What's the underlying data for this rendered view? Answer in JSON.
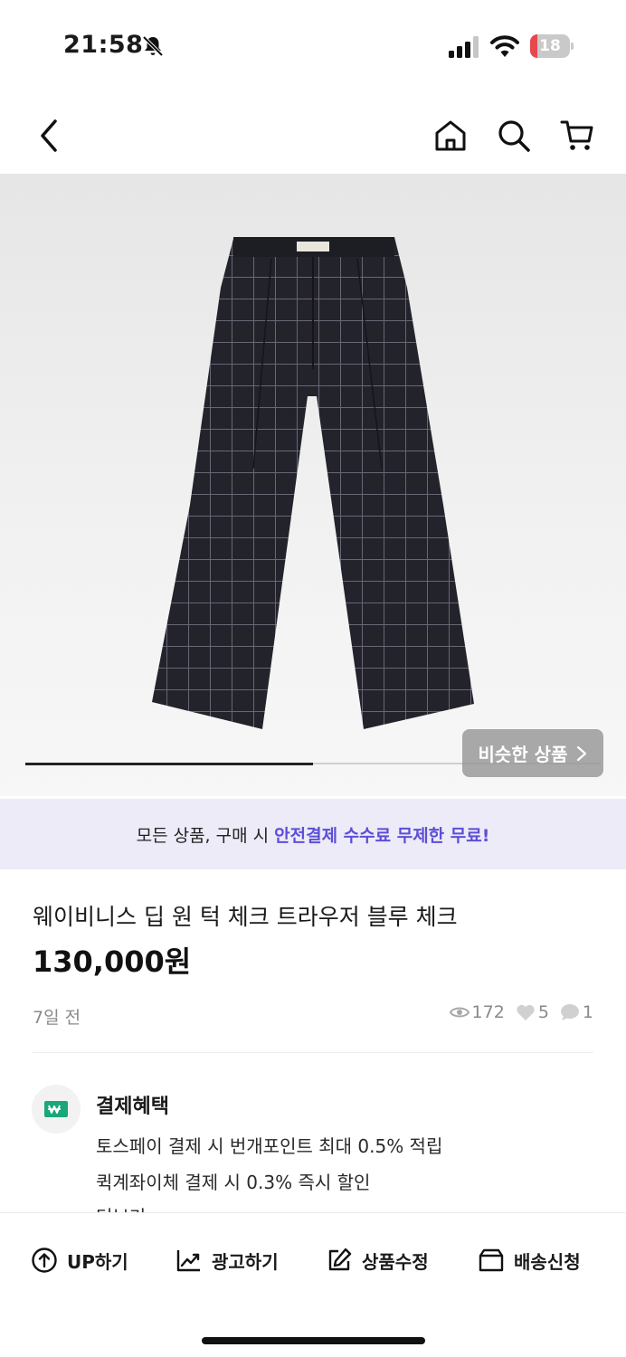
{
  "status_bar": {
    "time": "21:58",
    "battery": "18",
    "battery_level": 0.18
  },
  "nav": {
    "icons": [
      "back-icon",
      "home-icon",
      "search-icon",
      "cart-icon"
    ]
  },
  "gallery": {
    "progress": 0.5,
    "similar_label": "비슷한 상품"
  },
  "promo": {
    "prefix": "모든 상품, 구매 시",
    "highlight": "안전결제 수수료 무제한 무료!"
  },
  "product": {
    "title": "웨이비니스 딥 원 턱 체크 트라우저 블루 체크",
    "price": "130,000원",
    "posted": "7일 전",
    "views": "172",
    "likes": "5",
    "comments": "1"
  },
  "benefits": {
    "title": "결제혜택",
    "lines": [
      "토스페이 결제 시 번개포인트 최대 0.5% 적립",
      "퀵계좌이체 결제 시 0.3% 즉시 할인"
    ],
    "more": "더보기"
  },
  "actions": [
    {
      "label": "UP하기",
      "icon": "up-circle-icon"
    },
    {
      "label": "광고하기",
      "icon": "trend-chart-icon"
    },
    {
      "label": "상품수정",
      "icon": "edit-icon"
    },
    {
      "label": "배송신청",
      "icon": "box-icon"
    }
  ],
  "colors": {
    "accent": "#5d4fd6",
    "banner_bg": "#ecebf7",
    "benefit_icon": "#1aa77a"
  }
}
